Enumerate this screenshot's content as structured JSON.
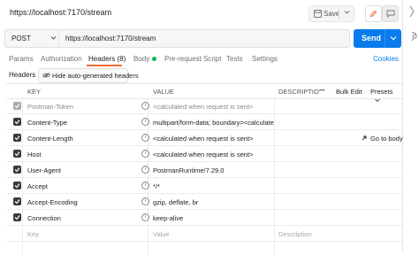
{
  "request": {
    "title": "https://localhost:7170/stream",
    "save_label": "Save",
    "method": "POST",
    "url": "https://localhost:7170/stream",
    "send_label": "Send"
  },
  "tabs": {
    "params": "Params",
    "authorization": "Authorization",
    "headers": "Headers (8)",
    "body": "Body",
    "prerequest": "Pre-request Script",
    "tests": "Tests",
    "settings": "Settings",
    "cookies": "Cookies"
  },
  "headers_section": {
    "label": "Headers",
    "hide_button": "Hide auto-generated headers"
  },
  "table": {
    "col_key": "KEY",
    "col_value": "VALUE",
    "col_description": "DESCRIPTIO",
    "more": "•••",
    "bulk_edit": "Bulk Edit",
    "presets": "Presets",
    "rows": [
      {
        "key": "Postman-Token",
        "value": "<calculated when request is sent>",
        "disabled": true
      },
      {
        "key": "Content-Type",
        "value": "multipart/form-data; boundary=<calculate..."
      },
      {
        "key": "Content-Length",
        "value": "<calculated when request is sent>",
        "goto": "Go to body"
      },
      {
        "key": "Host",
        "value": "<calculated when request is sent>"
      },
      {
        "key": "User-Agent",
        "value": "PostmanRuntime/7.29.0"
      },
      {
        "key": "Accept",
        "value": "*/*"
      },
      {
        "key": "Accept-Encoding",
        "value": "gzip, deflate, br"
      },
      {
        "key": "Connection",
        "value": "keep-alive"
      }
    ],
    "placeholder": {
      "key": "Key",
      "value": "Value",
      "description": "Description"
    }
  },
  "colors": {
    "send": "#097bed",
    "accent": "#f26b3a",
    "body_dot": "#0cbb52",
    "link": "#097bed"
  }
}
